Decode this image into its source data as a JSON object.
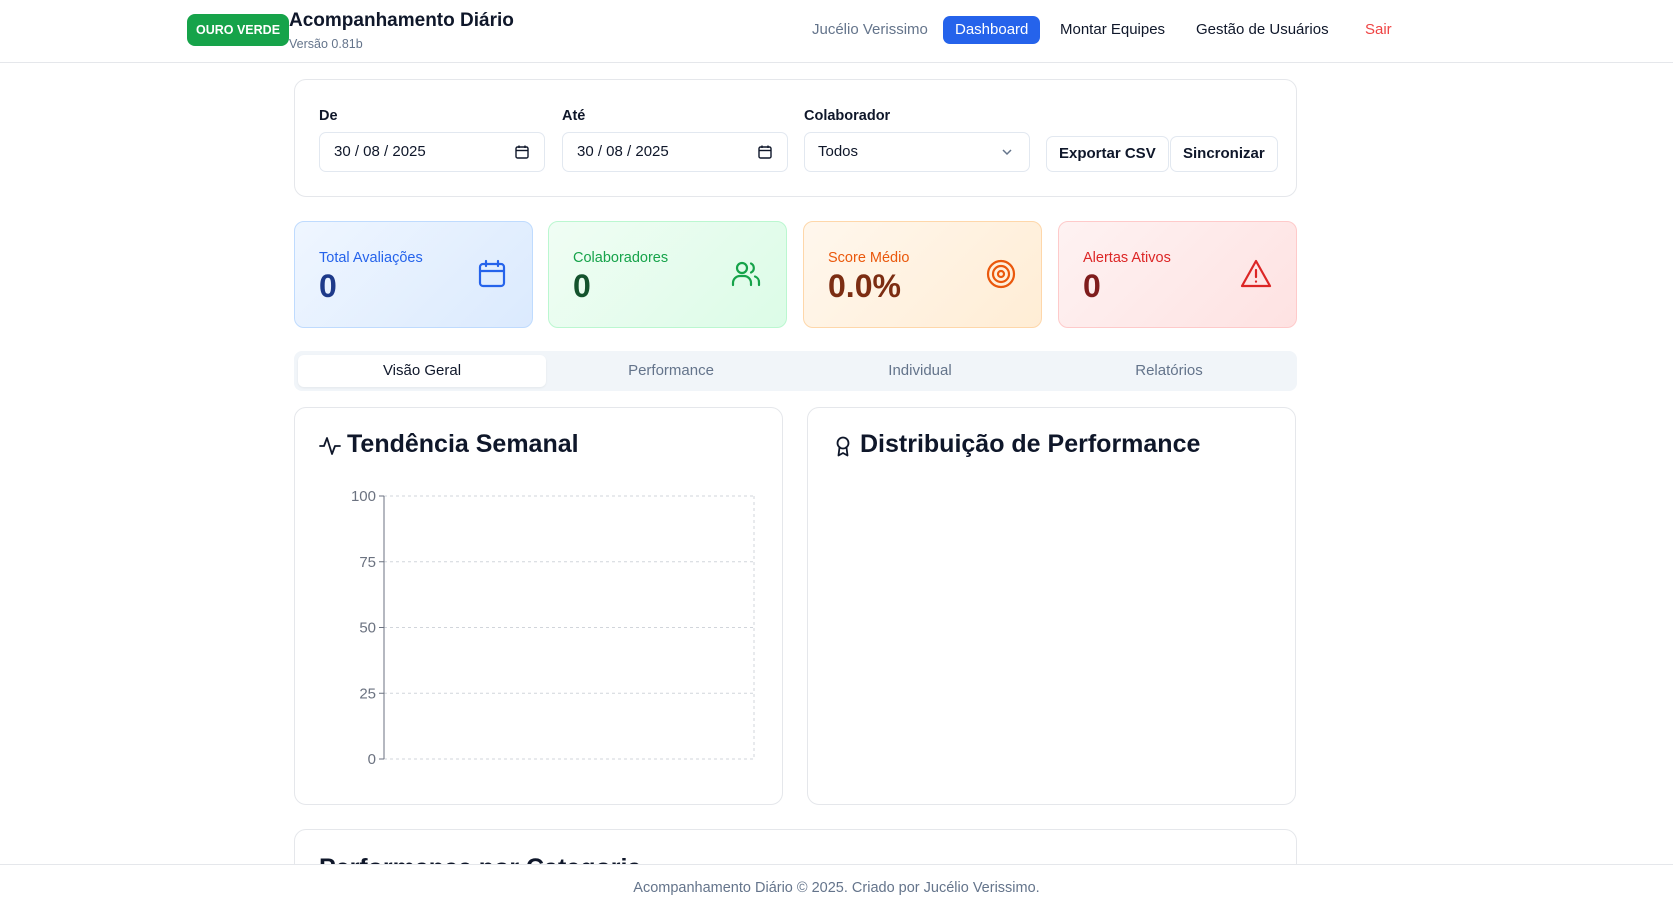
{
  "header": {
    "brand_badge": "OURO VERDE",
    "title": "Acompanhamento Diário",
    "version": "Versão 0.81b",
    "user_name": "Jucélio Verissimo",
    "nav": {
      "dashboard": "Dashboard",
      "montar_equipes": "Montar Equipes",
      "gestao_usuarios": "Gestão de Usuários",
      "sair": "Sair"
    }
  },
  "filters": {
    "from_label": "De",
    "from_value": "30 / 08 / 2025",
    "to_label": "Até",
    "to_value": "30 / 08 / 2025",
    "collaborator_label": "Colaborador",
    "collaborator_value": "Todos",
    "export_label": "Exportar CSV",
    "sync_label": "Sincronizar"
  },
  "stats": [
    {
      "label": "Total Avaliações",
      "value": "0",
      "icon": "calendar-icon",
      "color": "#2563eb"
    },
    {
      "label": "Colaboradores",
      "value": "0",
      "icon": "users-icon",
      "color": "#16a34a"
    },
    {
      "label": "Score Médio",
      "value": "0.0%",
      "icon": "target-icon",
      "color": "#ea580c"
    },
    {
      "label": "Alertas Ativos",
      "value": "0",
      "icon": "alert-triangle-icon",
      "color": "#dc2626"
    }
  ],
  "tabs": [
    "Visão Geral",
    "Performance",
    "Individual",
    "Relatórios"
  ],
  "active_tab": "Visão Geral",
  "trend_panel": {
    "title": "Tendência Semanal",
    "icon": "activity-icon"
  },
  "distribution_panel": {
    "title": "Distribuição de Performance",
    "icon": "award-icon"
  },
  "category_panel": {
    "title": "Performance por Categoria"
  },
  "chart_data": {
    "type": "line",
    "x": [],
    "series": [],
    "ylim": [
      0,
      100
    ],
    "yticks": [
      "0",
      "25",
      "50",
      "75",
      "100"
    ],
    "grid": true
  },
  "footer": {
    "text": "Acompanhamento Diário © 2025. Criado por Jucélio Verissimo."
  }
}
